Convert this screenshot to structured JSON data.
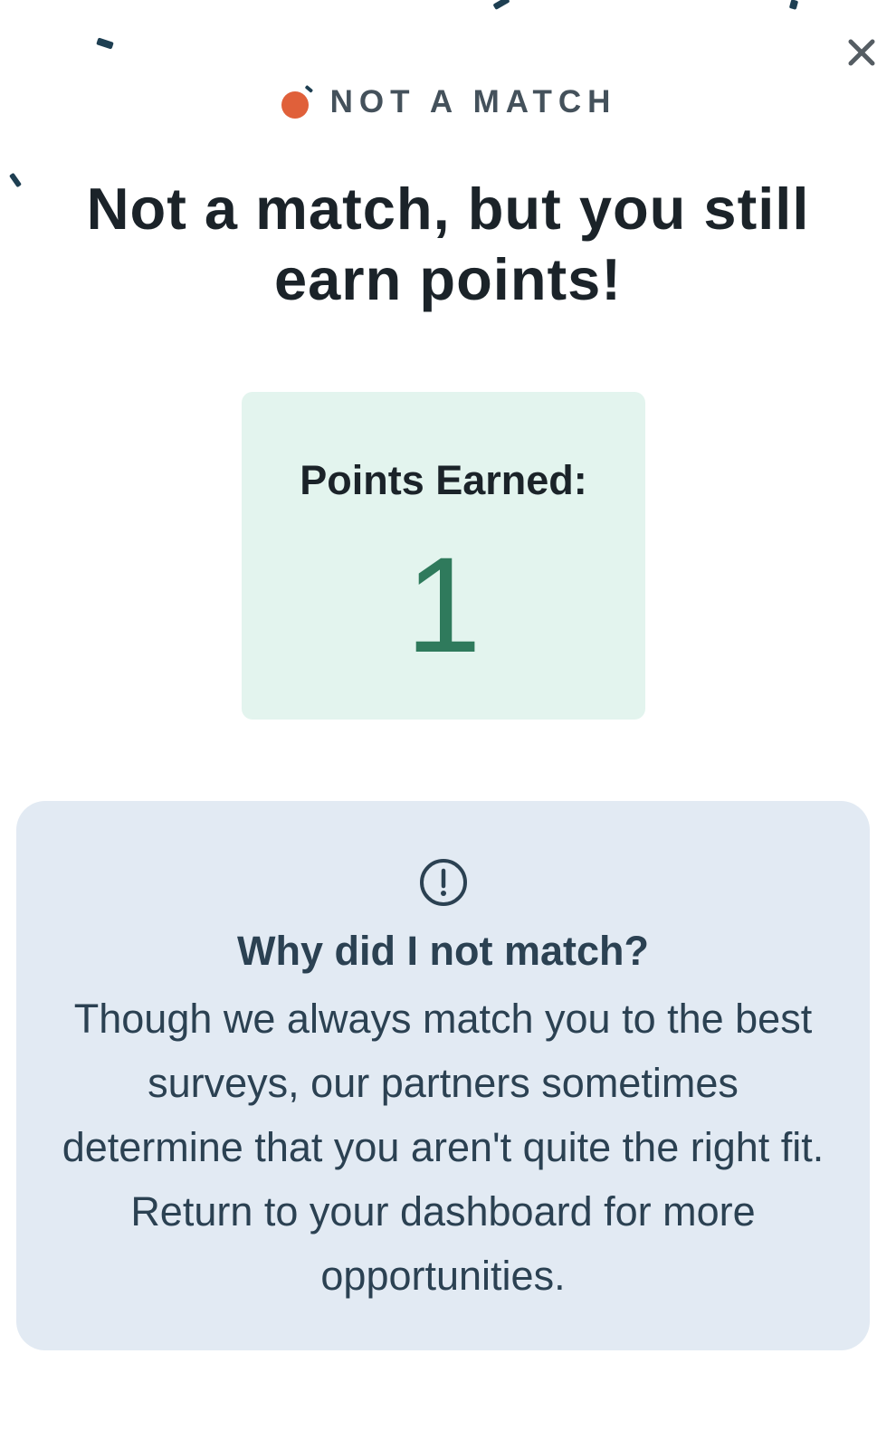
{
  "header": {
    "eyebrow_label": "NOT A MATCH",
    "title": "Not a match, but you still earn points!",
    "close_icon": "close-icon",
    "status_icon": "orange-dot-icon"
  },
  "points": {
    "label": "Points Earned:",
    "value": "1"
  },
  "info": {
    "icon": "alert-circle-icon",
    "heading": "Why did I not match?",
    "body": "Though we always match you to the best surveys, our partners sometimes determine that you aren't quite the right fit. Return to your dashboard for more opportunities."
  },
  "colors": {
    "accent_orange": "#e0603a",
    "points_green": "#2f7a5c",
    "points_card_bg": "#e3f4ee",
    "info_card_bg": "#e2eaf3",
    "confetti": "#1e3f52"
  }
}
